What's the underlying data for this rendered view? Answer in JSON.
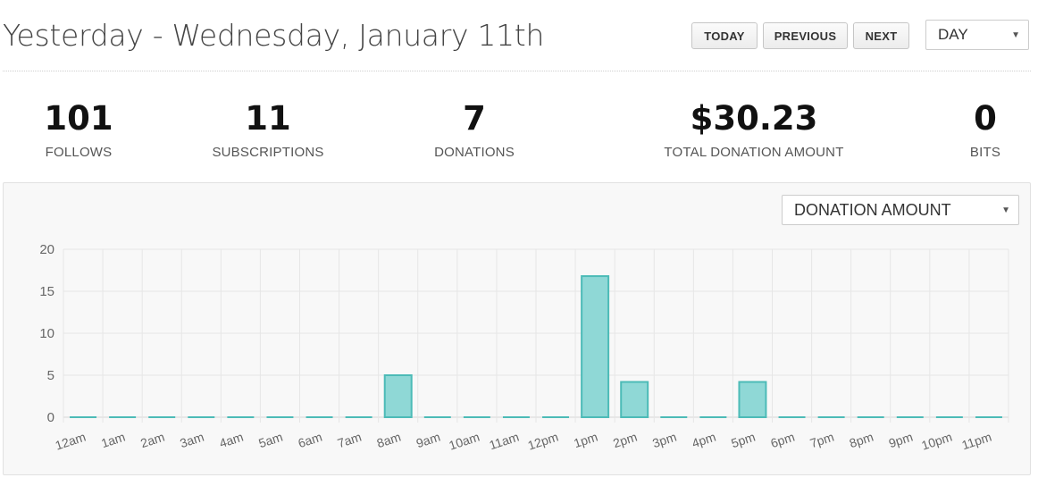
{
  "header": {
    "title": "Yesterday - Wednesday, January 11th",
    "buttons": {
      "today": "TODAY",
      "previous": "PREVIOUS",
      "next": "NEXT"
    },
    "period_select": "DAY"
  },
  "stats": [
    {
      "value": "101",
      "label": "FOLLOWS"
    },
    {
      "value": "11",
      "label": "SUBSCRIPTIONS"
    },
    {
      "value": "7",
      "label": "DONATIONS"
    },
    {
      "value": "$30.23",
      "label": "TOTAL DONATION AMOUNT"
    },
    {
      "value": "0",
      "label": "BITS"
    }
  ],
  "metric_select": "DONATION AMOUNT",
  "chart_data": {
    "type": "bar",
    "categories": [
      "12am",
      "1am",
      "2am",
      "3am",
      "4am",
      "5am",
      "6am",
      "7am",
      "8am",
      "9am",
      "10am",
      "11am",
      "12pm",
      "1pm",
      "2pm",
      "3pm",
      "4pm",
      "5pm",
      "6pm",
      "7pm",
      "8pm",
      "9pm",
      "10pm",
      "11pm"
    ],
    "values": [
      0,
      0,
      0,
      0,
      0,
      0,
      0,
      0,
      5,
      0,
      0,
      0,
      0,
      16.8,
      4.2,
      0,
      0,
      4.2,
      0,
      0,
      0,
      0,
      0,
      0
    ],
    "ylim": [
      0,
      20
    ],
    "yticks": [
      0,
      5,
      10,
      15,
      20
    ],
    "grid": true,
    "bar_fill": "#8fd8d6",
    "bar_stroke": "#4cbbb7"
  }
}
